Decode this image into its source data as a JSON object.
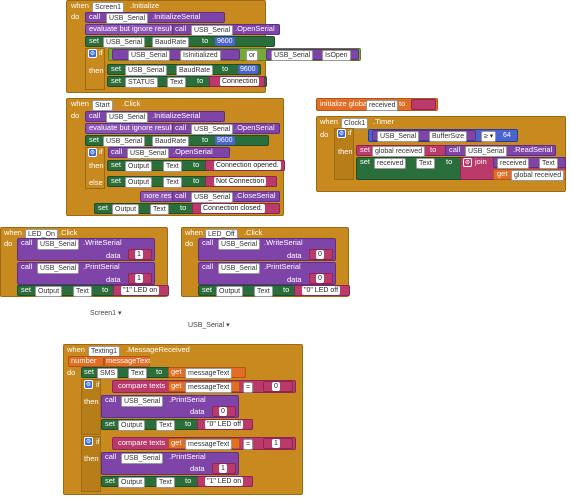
{
  "kw": {
    "when": "when",
    "do": "do",
    "call": "call",
    "set": "set",
    "to": "to",
    "if": "if",
    "then": "then",
    "else": "else",
    "or": "or",
    "data": "data",
    "join": "join",
    "get": "get",
    "eval_ignore": "evaluate but ignore result",
    "ignore_short": "nore result",
    "compare": "compare texts",
    "eq": "=",
    "init_global": "initialize global"
  },
  "components": {
    "screen1": "Screen1",
    "start": "Start",
    "usb": "USB_Serial",
    "output": "Output",
    "status": "STATUS",
    "led_on": "LED_On",
    "led_off": "LED_Off",
    "clock1": "Clock1",
    "texting1": "Texting1",
    "sms": "SMS"
  },
  "events": {
    "initialize": ".Initialize",
    "click": ".Click",
    "timer": ".Timer",
    "message_received": ".MessageReceived"
  },
  "methods": {
    "initialize_serial": ".InitializeSerial",
    "open_serial": ".OpenSerial",
    "close_serial": ".CloseSerial",
    "write_serial": ".WriteSerial",
    "print_serial": ".PrintSerial",
    "read_serial": ".ReadSerial"
  },
  "props": {
    "baud_rate": "BaudRate",
    "text": "Text",
    "is_initialized": "IsInitialized",
    "is_open": "IsOpen",
    "buffer_size": "BufferSize"
  },
  "values": {
    "baud": "9600",
    "connection": "Connection",
    "conn_opened": "Connection opened.",
    "not_connection": "Not Connection",
    "conn_closed": "Connection closed.",
    "one": "1",
    "zero": "0",
    "led_on_text": "\"1\" LED on",
    "led_off_text": "\"0\" LED off",
    "buffer": "64",
    "empty": " ",
    "zero_led_off": "\"0\" LED off",
    "one_led_on": "\"1\" LED on"
  },
  "vars": {
    "received": "received",
    "global_received": "global received",
    "number": "number",
    "message_text": "messageText"
  },
  "misc": {
    "screen1_dropdown": "Screen1",
    "usb_dropdown": "USB_Serial"
  }
}
